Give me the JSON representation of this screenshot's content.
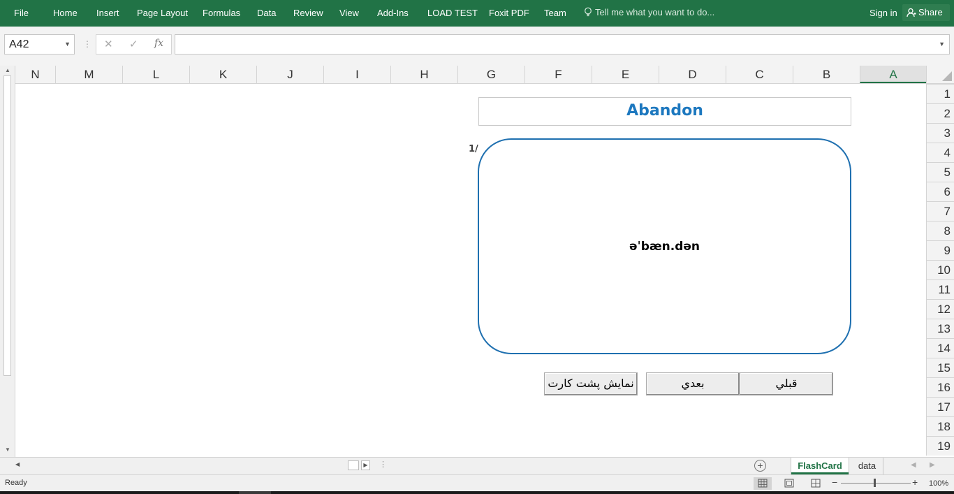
{
  "ribbon": {
    "tabs": [
      "File",
      "Home",
      "Insert",
      "Page Layout",
      "Formulas",
      "Data",
      "Review",
      "View",
      "Add-Ins",
      "LOAD TEST",
      "Foxit PDF",
      "Team"
    ],
    "tell_me": "Tell me what you want to do...",
    "sign_in": "Sign in",
    "share": "Share"
  },
  "formula_bar": {
    "name_box": "A42",
    "cancel_icon": "✕",
    "enter_icon": "✓",
    "fx_label": "fx",
    "formula": ""
  },
  "grid": {
    "columns": [
      "N",
      "M",
      "L",
      "K",
      "J",
      "I",
      "H",
      "G",
      "F",
      "E",
      "D",
      "C",
      "B",
      "A"
    ],
    "selected_column": "A",
    "rows": [
      "1",
      "2",
      "3",
      "4",
      "5",
      "6",
      "7",
      "8",
      "9",
      "10",
      "11",
      "12",
      "13",
      "14",
      "15",
      "16",
      "17",
      "18",
      "19"
    ]
  },
  "flashcard": {
    "word": "Abandon",
    "counter": "1/",
    "phonetic": "əˈbæn.dən",
    "buttons": {
      "show_back": "نمایش پشت کارت",
      "next": "بعدي",
      "previous": "قبلي"
    }
  },
  "sheet_tabs": {
    "active": "FlashCard",
    "other": "data"
  },
  "status_bar": {
    "status": "Ready",
    "zoom": "100%"
  },
  "colors": {
    "excel_green": "#217346",
    "title_blue": "#1d78bf",
    "card_border": "#1f70b0"
  }
}
